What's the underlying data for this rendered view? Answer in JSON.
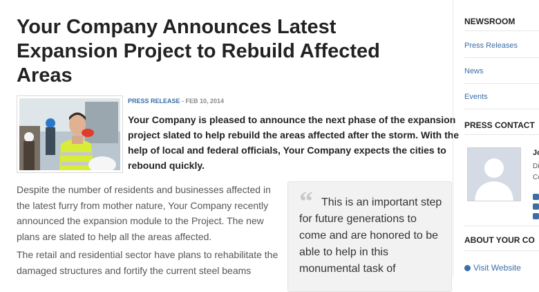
{
  "article": {
    "title": "Your Company Announces Latest Expansion Project to Rebuild Affected Areas",
    "category": "PRESS RELEASE",
    "date": " - FEB 10, 2014",
    "lead": "Your Company is pleased to announce the next phase of the expansion project slated to help rebuild the areas affected after the storm. With the help of local and federal officials, Your Company expects the cities to rebound quickly.",
    "paragraphs": [
      "Despite the number of residents and businesses affected in the latest furry from mother nature, Your Company recently announced the expansion module to the Project. The new plans are slated to help all the areas affected.",
      "The retail and residential sector have plans to rehabilitate the damaged structures and fortify the current steel beams"
    ],
    "quote": {
      "mark": "“",
      "text": "This is an important step for future generations to come and are honored to be able to help in this monumental task of"
    }
  },
  "sidebar": {
    "newsroom_heading": "NEWSROOM",
    "links": [
      "Press Releases",
      "News",
      "Events"
    ],
    "press_contact_heading": "PRESS CONTACT",
    "contact": {
      "name": "Jo",
      "line1": "Di",
      "line2": "Co"
    },
    "about_heading": "ABOUT YOUR CO",
    "visit_label": "Visit Website"
  },
  "colors": {
    "link": "#3a6ea5",
    "title": "#222222",
    "quote_bg": "#f2f2f2"
  },
  "icons": [
    "quote-mark-icon",
    "email-icon",
    "twitter-icon",
    "linkedin-icon",
    "globe-icon",
    "avatar-placeholder-icon"
  ]
}
